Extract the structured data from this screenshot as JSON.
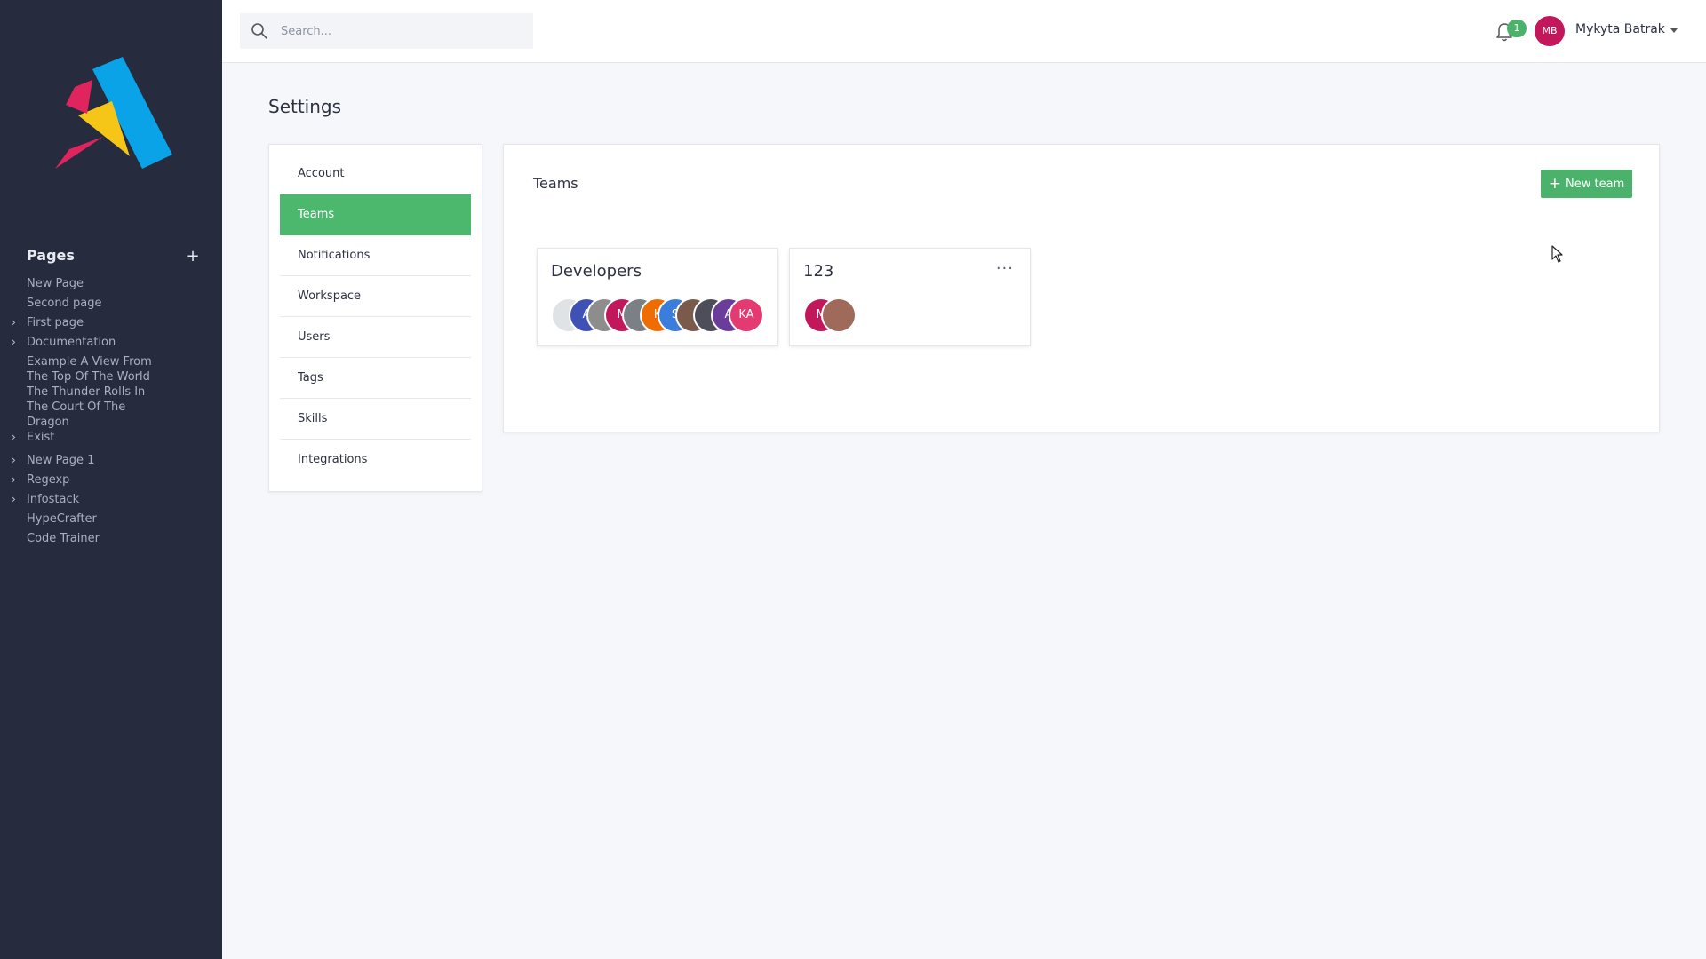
{
  "sidebar": {
    "pages_title": "Pages",
    "add_label": "+",
    "items": [
      {
        "label": "New Page",
        "expandable": false
      },
      {
        "label": "Second page",
        "expandable": false
      },
      {
        "label": "First page",
        "expandable": true
      },
      {
        "label": "Documentation",
        "expandable": true
      },
      {
        "label": "Example A View From The Top Of The World The Thunder Rolls In The Court Of The Dragon",
        "expandable": false
      },
      {
        "label": "Exist",
        "expandable": true
      },
      {
        "label": "New Page 1",
        "expandable": true
      },
      {
        "label": "Regexp",
        "expandable": true
      },
      {
        "label": "Infostack",
        "expandable": true
      },
      {
        "label": "HypeCrafter",
        "expandable": false
      },
      {
        "label": "Code Trainer",
        "expandable": false
      }
    ]
  },
  "topbar": {
    "search_placeholder": "Search...",
    "notification_count": "1",
    "user_initials": "MB",
    "user_name": "Mykyta Batrak"
  },
  "main": {
    "title": "Settings",
    "nav": [
      {
        "label": "Account",
        "active": false
      },
      {
        "label": "Teams",
        "active": true
      },
      {
        "label": "Notifications",
        "active": false
      },
      {
        "label": "Workspace",
        "active": false
      },
      {
        "label": "Users",
        "active": false
      },
      {
        "label": "Tags",
        "active": false
      },
      {
        "label": "Skills",
        "active": false
      },
      {
        "label": "Integrations",
        "active": false
      }
    ],
    "teams_panel": {
      "title": "Teams",
      "new_team_label": "New team",
      "teams": [
        {
          "name": "Developers",
          "members": [
            {
              "initials": "",
              "color": "#dfe3e6"
            },
            {
              "initials": "A",
              "color": "#3f51b5"
            },
            {
              "initials": "",
              "color": "#8d8d8d"
            },
            {
              "initials": "M",
              "color": "#c2185b"
            },
            {
              "initials": "",
              "color": "#7b7f86"
            },
            {
              "initials": "K",
              "color": "#ef6c00"
            },
            {
              "initials": "S",
              "color": "#3b7ddd"
            },
            {
              "initials": "",
              "color": "#7a5a4a"
            },
            {
              "initials": "",
              "color": "#4e4e5a"
            },
            {
              "initials": "A",
              "color": "#6a3d9a"
            },
            {
              "initials": "KA",
              "color": "#e53971"
            }
          ]
        },
        {
          "name": "123",
          "members": [
            {
              "initials": "M",
              "color": "#c2185b"
            },
            {
              "initials": "",
              "color": "#a06a5a"
            }
          ]
        }
      ]
    }
  },
  "colors": {
    "sidebar_bg": "#262b3d",
    "accent_green": "#4ab26b",
    "user_avatar": "#c2185b"
  }
}
